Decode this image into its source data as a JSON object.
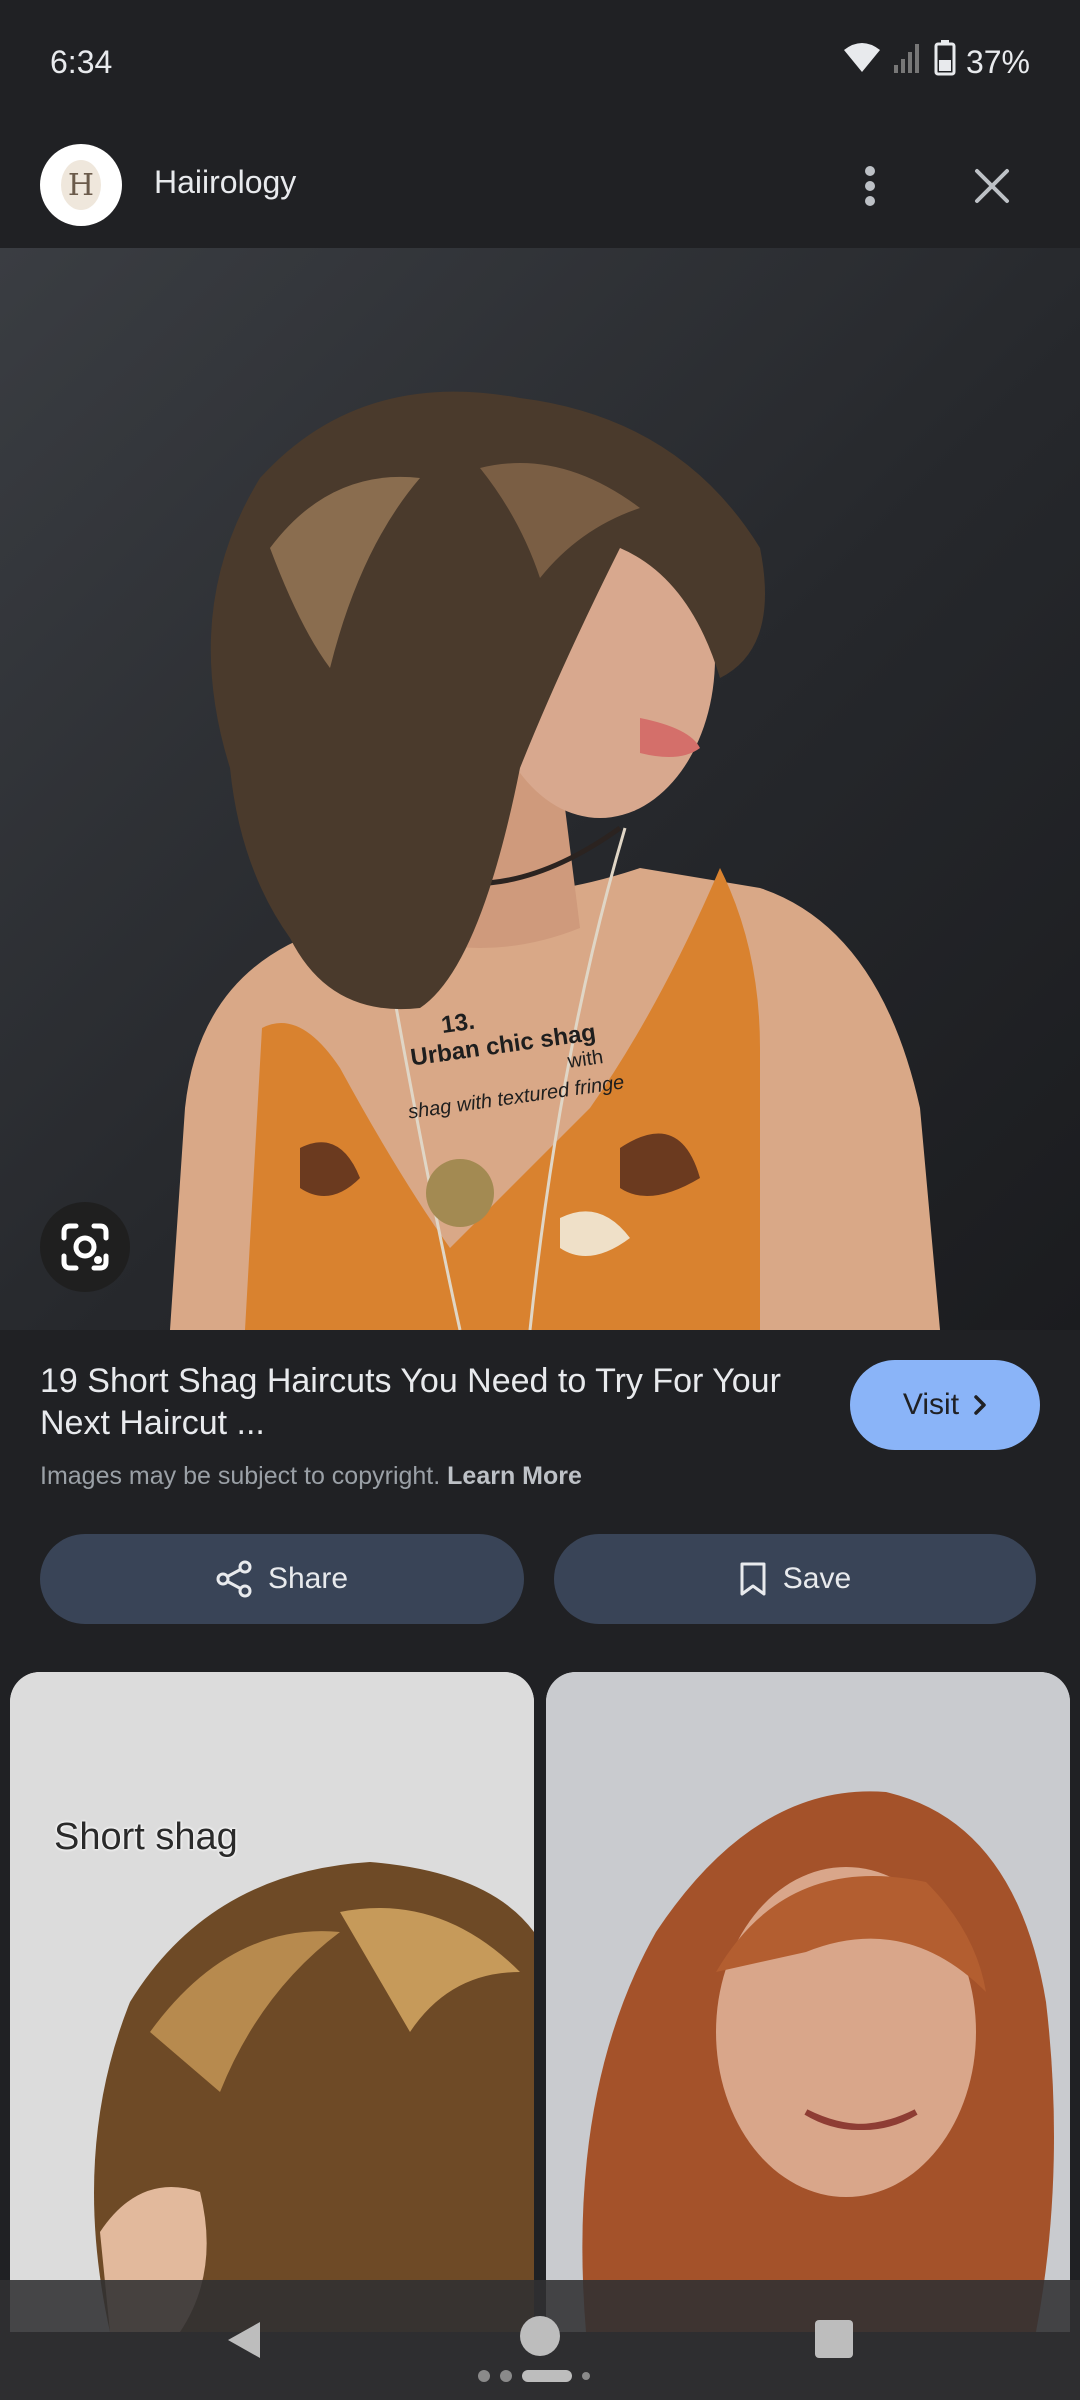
{
  "status_bar": {
    "time": "6:34",
    "battery": "37%",
    "icons": [
      "wifi-icon",
      "cell-signal-icon",
      "battery-icon"
    ]
  },
  "header": {
    "source_name": "Haiirology",
    "logo_letter": "H",
    "icons": [
      "more-vert-icon",
      "close-icon"
    ]
  },
  "main_image": {
    "overlay_text_line1": "13.",
    "overlay_text_line2": "Urban chic shag",
    "overlay_text_line3": "with",
    "overlay_text_line4": "shag with textured fringe"
  },
  "result": {
    "title": "19 Short Shag Haircuts You Need to Try For Your Next Haircut ...",
    "copyright_text": "Images may be subject to copyright.",
    "learn_more": "Learn More",
    "visit_label": "Visit"
  },
  "actions": {
    "share_label": "Share",
    "save_label": "Save"
  },
  "related": [
    {
      "caption": "Short shag"
    },
    {
      "caption": ""
    }
  ],
  "colors": {
    "background": "#202124",
    "visit_button": "#8ab4f8",
    "action_pill": "#394457"
  }
}
